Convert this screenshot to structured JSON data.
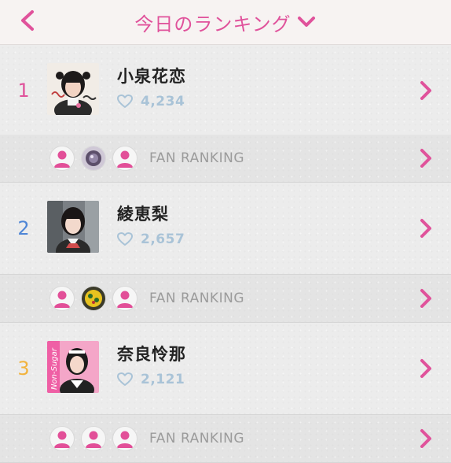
{
  "header": {
    "title": "今日のランキング"
  },
  "colors": {
    "accent": "#e0529b",
    "like": "#a9c3d7"
  },
  "rankings": [
    {
      "rank": "1",
      "rank_color": "#e0529b",
      "name": "小泉花恋",
      "likes": "4,234",
      "fan_label": "FAN RANKING"
    },
    {
      "rank": "2",
      "rank_color": "#4f86d6",
      "name": "綾恵梨",
      "likes": "2,657",
      "fan_label": "FAN RANKING"
    },
    {
      "rank": "3",
      "rank_color": "#f2b33d",
      "name": "奈良怜那",
      "likes": "2,121",
      "fan_label": "FAN RANKING"
    }
  ],
  "thumb_texts": {
    "badge_3": "Non-Sugar"
  },
  "icons": {
    "back": "chevron-left-icon",
    "dropdown": "chevron-down-icon",
    "like": "heart-outline-icon",
    "next": "chevron-right-icon",
    "fan": "person-icon"
  }
}
